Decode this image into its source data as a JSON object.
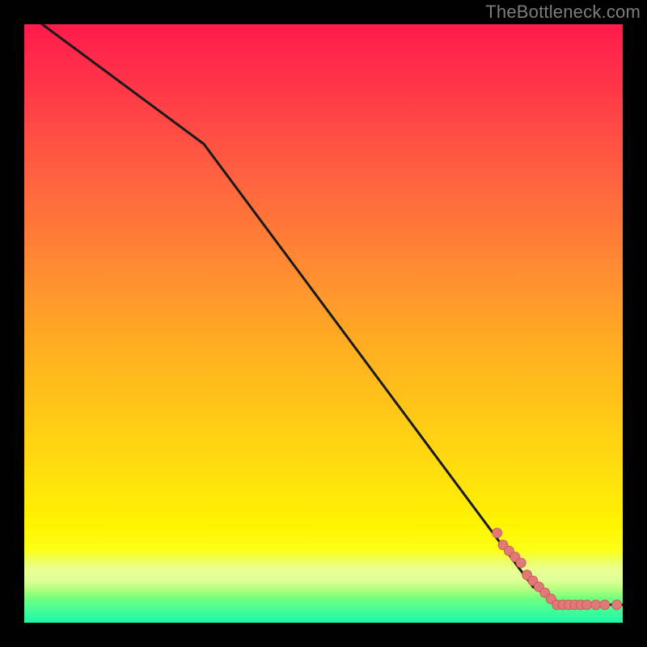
{
  "watermark_text": "TheBottleneck.com",
  "colors": {
    "page_bg": "#000000",
    "line": "#1a1a1a",
    "marker_fill": "#e07a78",
    "marker_stroke": "#cf5a58",
    "watermark": "#7d7d7d",
    "gradient_stops": [
      "#ff1b4a",
      "#ff4745",
      "#ff7e36",
      "#ffb31f",
      "#ffe10c",
      "#fcff18",
      "#58ff8f",
      "#19f7a8"
    ]
  },
  "chart_data": {
    "type": "line",
    "title": "",
    "xlabel": "",
    "ylabel": "",
    "xlim": [
      0,
      100
    ],
    "ylim": [
      0,
      100
    ],
    "grid": false,
    "legend": false,
    "line_points": [
      {
        "x": 3,
        "y": 100
      },
      {
        "x": 30,
        "y": 80
      },
      {
        "x": 85,
        "y": 6
      },
      {
        "x": 90,
        "y": 3
      },
      {
        "x": 100,
        "y": 3
      }
    ],
    "marker_points": [
      {
        "x": 79,
        "y": 15
      },
      {
        "x": 80,
        "y": 13
      },
      {
        "x": 81,
        "y": 12
      },
      {
        "x": 82,
        "y": 11
      },
      {
        "x": 83,
        "y": 10
      },
      {
        "x": 84,
        "y": 8
      },
      {
        "x": 85,
        "y": 7
      },
      {
        "x": 86,
        "y": 6
      },
      {
        "x": 87,
        "y": 5
      },
      {
        "x": 88,
        "y": 4
      },
      {
        "x": 89,
        "y": 3
      },
      {
        "x": 90,
        "y": 3
      },
      {
        "x": 91,
        "y": 3
      },
      {
        "x": 92,
        "y": 3
      },
      {
        "x": 93,
        "y": 3
      },
      {
        "x": 94,
        "y": 3
      },
      {
        "x": 95.5,
        "y": 3
      },
      {
        "x": 97,
        "y": 3
      },
      {
        "x": 99,
        "y": 3
      }
    ],
    "marker_radius_data_units": 0.8
  }
}
